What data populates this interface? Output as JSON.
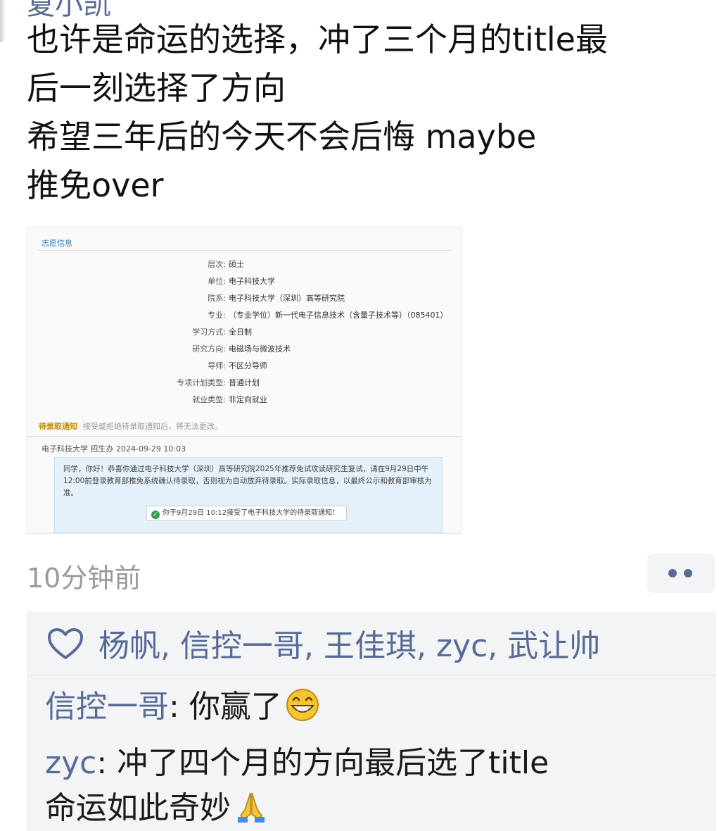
{
  "post": {
    "author_partial": "夏小凯",
    "text_lines": [
      "也许是命运的选择，冲了三个月的title最",
      "后一刻选择了方向",
      "希望三年后的今天不会后悔 maybe",
      "推免over"
    ],
    "time": "10分钟前"
  },
  "screenshot": {
    "section_title": "志愿信息",
    "fields": [
      {
        "label": "层次:",
        "value": "硕士"
      },
      {
        "label": "单位:",
        "value": "电子科技大学"
      },
      {
        "label": "院系:",
        "value": "电子科技大学（深圳）高等研究院"
      },
      {
        "label": "专业:",
        "value": "（专业学位）新一代电子信息技术（含量子技术等）（085401）"
      },
      {
        "label": "学习方式:",
        "value": "全日制"
      },
      {
        "label": "研究方向:",
        "value": "电磁场与微波技术"
      },
      {
        "label": "导师:",
        "value": "不区分导师"
      },
      {
        "label": "专项计划类型:",
        "value": "普通计划"
      },
      {
        "label": "就业类型:",
        "value": "非定向就业"
      }
    ],
    "notice_tag": "待录取通知",
    "notice_text": "接受或拒绝待录取通知后，将无法更改。",
    "sender": "电子科技大学 招生办 2024-09-29 10:03",
    "message": "同学，你好！恭喜你通过电子科技大学（深圳）高等研究院2025年推荐免试攻读研究生复试，请在9月29日中午12:00前登录教育部推免系统确认待录取，否则视为自动放弃待录取。实际录取信息，以最终公示和教育部审核为准。",
    "confirm": "你于9月29日 10:12接受了电子科技大学的待录取通知！"
  },
  "likes": {
    "names": [
      "杨帆",
      "信控一哥",
      "王佳琪",
      "zyc",
      "武让帅"
    ]
  },
  "comments": [
    {
      "author": "信控一哥",
      "text": "你赢了",
      "emoji": "grinning-face-emoji"
    },
    {
      "author": "zyc",
      "text": "冲了四个月的方向最后选了title",
      "text2": "命运如此奇妙",
      "emoji": "folded-hands-emoji"
    }
  ],
  "colors": {
    "link": "#576b95",
    "panel_bg": "#f3f4f6",
    "muted": "#9a9a9a"
  }
}
